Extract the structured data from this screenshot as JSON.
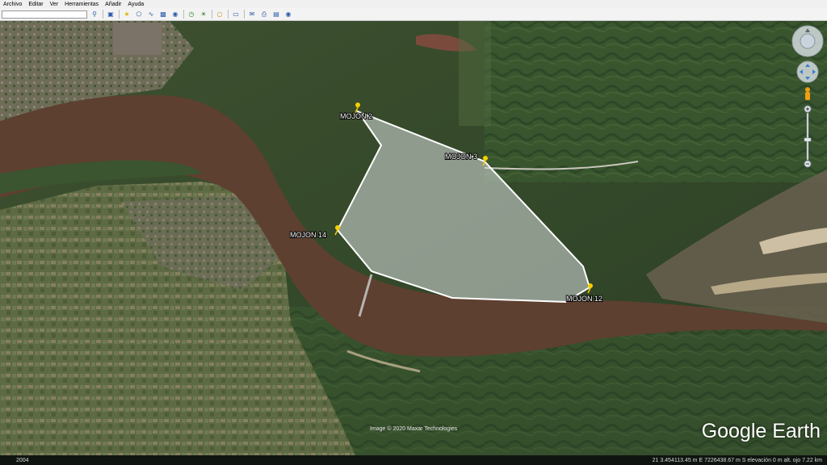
{
  "menu": {
    "items": [
      {
        "label": "Archivo"
      },
      {
        "label": "Editar"
      },
      {
        "label": "Ver"
      },
      {
        "label": "Herramientas"
      },
      {
        "label": "Añadir"
      },
      {
        "label": "Ayuda"
      }
    ]
  },
  "toolbar": {
    "search_value": "",
    "icons": [
      "search-icon",
      "sidebar-icon",
      "placemark-icon",
      "polygon-icon",
      "path-icon",
      "image-overlay-icon",
      "record-tour-icon",
      "historical-imagery-icon",
      "sunlight-icon",
      "planets-icon",
      "ruler-icon",
      "email-icon",
      "print-icon",
      "save-image-icon",
      "maps-icon"
    ]
  },
  "placemarks": [
    {
      "label": "MOJON 2"
    },
    {
      "label": "MOJON 3"
    },
    {
      "label": "MOJON 14"
    },
    {
      "label": "MOJON 12"
    }
  ],
  "map": {
    "credit": "Image © 2020 Maxar Technologies",
    "brand": "Google Earth",
    "polygon_color": "#ffffff"
  },
  "status": {
    "year": "2004",
    "coords": "21 3.454113.45 m E 7226438.67 m S   elevación     0 m     alt. ojo    7.22 km"
  }
}
